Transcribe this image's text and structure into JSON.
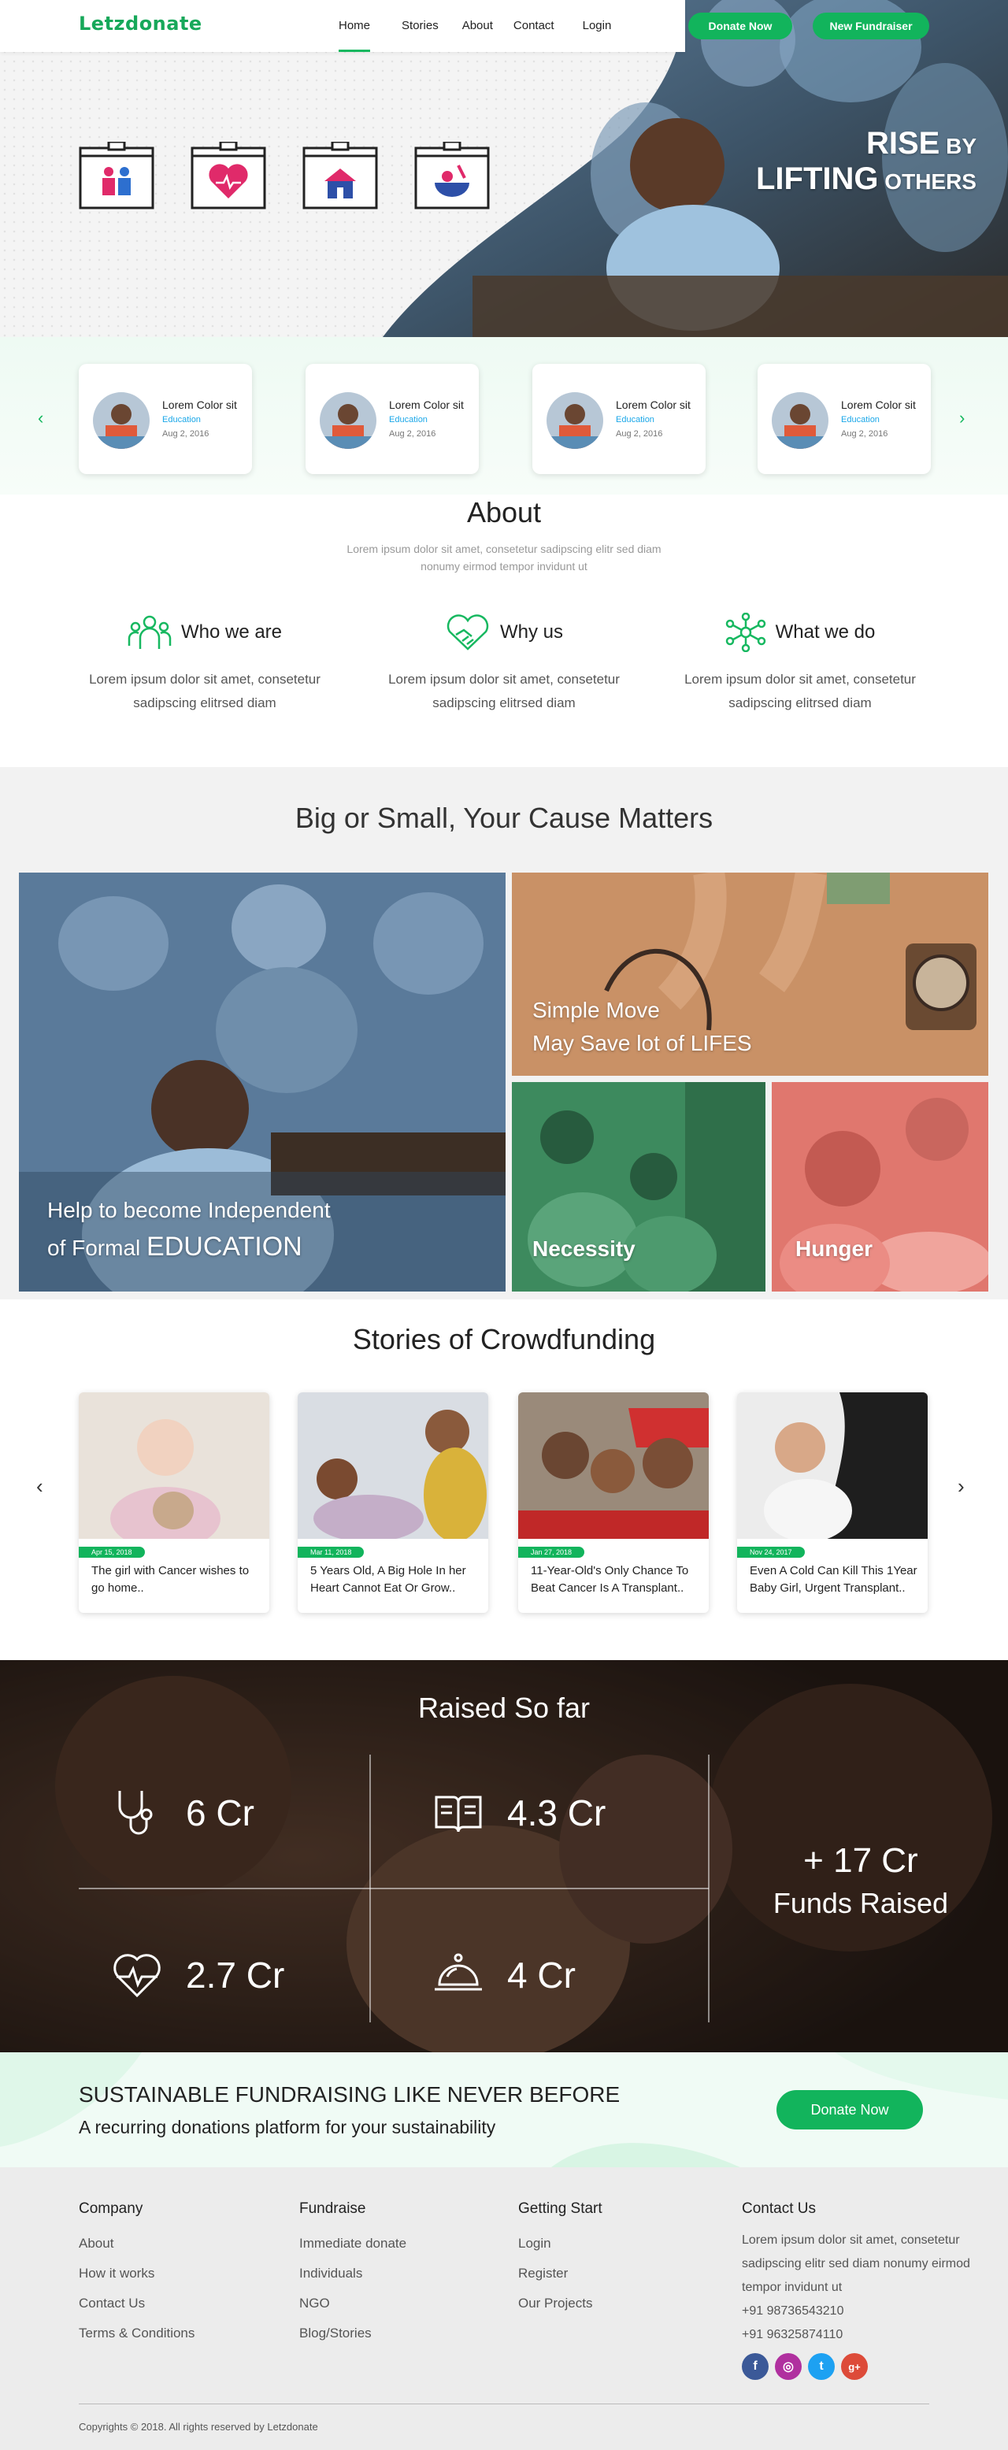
{
  "header": {
    "logo": "Letzdonate",
    "nav": [
      "Home",
      "Stories",
      "About",
      "Contact",
      "Login"
    ],
    "active_nav": "Home",
    "donate_now": "Donate Now",
    "new_fundraiser": "New Fundraiser"
  },
  "hero": {
    "tagline_line1_big": "RISE",
    "tagline_line1_small": " BY",
    "tagline_line2_big": "LIFTING",
    "tagline_line2_small": " OTHERS",
    "icons": [
      "education-box-icon",
      "health-heart-box-icon",
      "shelter-box-icon",
      "food-box-icon"
    ]
  },
  "featured": {
    "cards": [
      {
        "title": "Lorem Color sit",
        "category": "Education",
        "date": "Aug 2, 2016"
      },
      {
        "title": "Lorem Color sit",
        "category": "Education",
        "date": "Aug 2, 2016"
      },
      {
        "title": "Lorem Color sit",
        "category": "Education",
        "date": "Aug 2, 2016"
      },
      {
        "title": "Lorem Color sit",
        "category": "Education",
        "date": "Aug 2, 2016"
      }
    ]
  },
  "about": {
    "title": "About",
    "subtitle": "Lorem ipsum dolor sit amet, consetetur sadipscing elitr sed diam nonumy eirmod tempor invidunt ut",
    "columns": [
      {
        "title": "Who we are",
        "text": "Lorem ipsum dolor sit amet, consetetur sadipscing elitrsed diam"
      },
      {
        "title": "Why us",
        "text": "Lorem ipsum dolor sit amet, consetetur sadipscing elitrsed diam"
      },
      {
        "title": "What we do",
        "text": "Lorem ipsum dolor sit amet, consetetur sadipscing elitrsed diam"
      }
    ]
  },
  "causes": {
    "title": "Big or Small, Your Cause Matters",
    "education_line1": "Help to become Independent",
    "education_line2_a": "of Formal ",
    "education_line2_b": "EDUCATION",
    "medical_line1": "Simple Move",
    "medical_line2_a": "May Save lot of ",
    "medical_line2_b": "LIFES",
    "necessity": "Necessity",
    "hunger": "Hunger"
  },
  "stories": {
    "title": "Stories of Crowdfunding",
    "cards": [
      {
        "date": "Apr 15, 2018",
        "text": "The girl with Cancer wishes to go home.."
      },
      {
        "date": "Mar 11, 2018",
        "text": "5 Years Old, A Big Hole In her Heart Cannot Eat Or Grow.."
      },
      {
        "date": "Jan 27, 2018",
        "text": "11-Year-Old's Only Chance To Beat Cancer Is A Transplant.."
      },
      {
        "date": "Nov 24, 2017",
        "text": "Even A Cold Can Kill This 1Year Baby Girl, Urgent Transplant.."
      }
    ]
  },
  "raised": {
    "title": "Raised So far",
    "stats": [
      {
        "icon": "stethoscope-icon",
        "value": "6 Cr"
      },
      {
        "icon": "book-icon",
        "value": "4.3 Cr"
      },
      {
        "icon": "heartbeat-icon",
        "value": "2.7 Cr"
      },
      {
        "icon": "food-cloche-icon",
        "value": "4 Cr"
      }
    ],
    "total": "+ 17 Cr",
    "total_label": "Funds Raised"
  },
  "sustain": {
    "heading": "SUSTAINABLE FUNDRAISING LIKE NEVER BEFORE",
    "sub": "A recurring donations platform for your sustainability",
    "button": "Donate Now"
  },
  "footer": {
    "company": {
      "title": "Company",
      "links": [
        "About",
        "How it works",
        "Contact Us",
        "Terms & Conditions"
      ]
    },
    "fundraise": {
      "title": "Fundraise",
      "links": [
        "Immediate donate",
        "Individuals",
        "NGO",
        "Blog/Stories"
      ]
    },
    "getting": {
      "title": "Getting Start",
      "links": [
        "Login",
        "Register",
        "Our Projects"
      ]
    },
    "contact": {
      "title": "Contact Us",
      "address": "Lorem ipsum dolor sit amet, consetetur sadipscing elitr sed diam nonumy eirmod tempor invidunt ut",
      "phones": [
        "+91 98736543210",
        "+91 96325874110"
      ]
    },
    "socials": [
      {
        "name": "facebook-icon",
        "glyph": "f",
        "color": "#3b5998"
      },
      {
        "name": "instagram-icon",
        "glyph": "◎",
        "color": "#b0309f"
      },
      {
        "name": "twitter-icon",
        "glyph": "t",
        "color": "#1da1f2"
      },
      {
        "name": "google-plus-icon",
        "glyph": "g+",
        "color": "#dd4b39"
      }
    ],
    "copyright": "Copyrights © 2018. All rights reserved by Letzdonate"
  },
  "colors": {
    "brand_green": "#12b45c",
    "link_blue": "#1aa7e8",
    "footer_bg": "#ececec"
  }
}
